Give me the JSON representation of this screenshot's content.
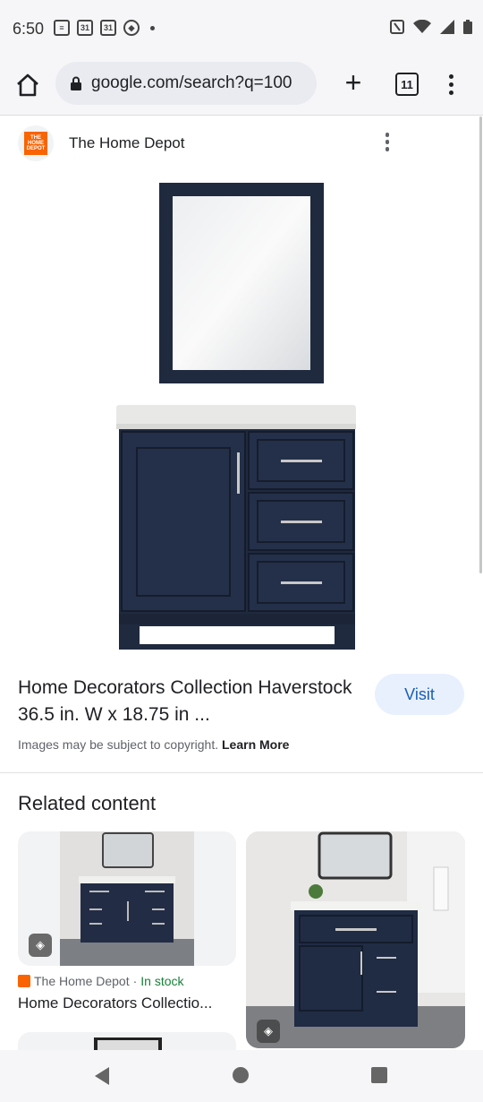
{
  "status": {
    "time": "6:50",
    "cal1": "31",
    "cal2": "31"
  },
  "browser": {
    "url": "google.com/search?q=100",
    "tab_count": "11"
  },
  "source": {
    "name": "The Home Depot",
    "logo_text": "THE HOME DEPOT"
  },
  "result": {
    "title": "Home Decorators Collection Haverstock 36.5 in. W x 18.75 in ...",
    "visit_label": "Visit",
    "copyright_text": "Images may be subject to copyright.",
    "learn_more": "Learn More"
  },
  "related": {
    "heading": "Related content",
    "cards": [
      {
        "source": "The Home Depot",
        "separator": "·",
        "availability": "In stock",
        "title": "Home Decorators Collectio..."
      }
    ]
  },
  "colors": {
    "accent": "#1a5fb4",
    "visit_bg": "#e8f0fe",
    "brand_orange": "#f96302",
    "in_stock": "#188038",
    "vanity_navy": "#1f2a3f"
  }
}
